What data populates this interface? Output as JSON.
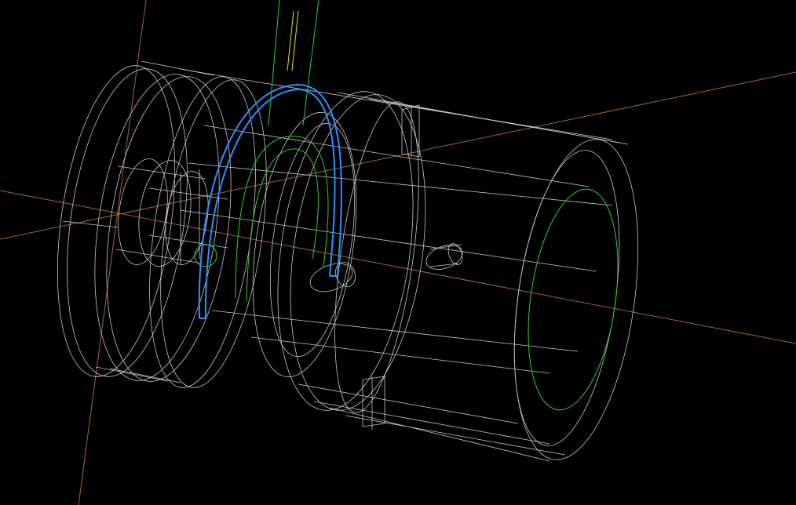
{
  "viewport": {
    "background": "#000000",
    "view_mode": "wireframe"
  },
  "colors": {
    "axis": "#b0602a",
    "wireframe": "#c8c8c8",
    "selected": "#2f8fff",
    "highlight": "#2fd02f",
    "cursor": "#e8e020"
  },
  "scene": {
    "axes": [
      {
        "name": "axis-x"
      },
      {
        "name": "axis-y"
      },
      {
        "name": "axis-z"
      }
    ],
    "objects": [
      {
        "name": "end-flange"
      },
      {
        "name": "spring-coil"
      },
      {
        "name": "main-cylinder-body"
      },
      {
        "name": "inner-bore"
      },
      {
        "name": "side-hole"
      },
      {
        "name": "top-slot"
      },
      {
        "name": "bottom-slot"
      }
    ]
  }
}
